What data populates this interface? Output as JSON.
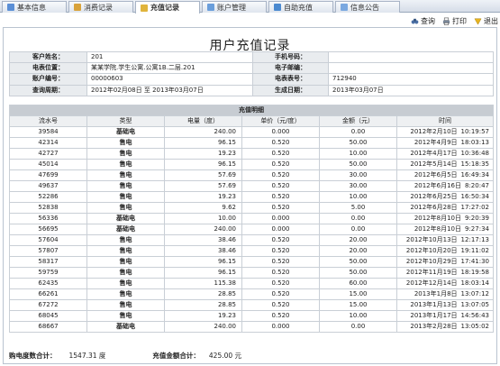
{
  "tabs": [
    {
      "label": "基本信息",
      "active": false
    },
    {
      "label": "消费记录",
      "active": false
    },
    {
      "label": "充值记录",
      "active": true
    },
    {
      "label": "账户管理",
      "active": false
    },
    {
      "label": "自助充值",
      "active": false
    },
    {
      "label": "信息公告",
      "active": false
    }
  ],
  "toolbar": {
    "query": "查询",
    "print": "打印",
    "exit": "退出"
  },
  "page_title": "用户充值记录",
  "info": {
    "name_label": "客户姓名：",
    "name": "201",
    "phone_label": "手机号码：",
    "phone": "",
    "location_label": "电表位置：",
    "location": "某某学院.学生公寓.公寓1B.二层.201",
    "email_label": "电子邮编：",
    "email": "",
    "account_label": "账户编号：",
    "account": "00000603",
    "meter_label": "电表表号：",
    "meter": "712940",
    "period_label": "查询周期：",
    "period": "2012年02月08日  至  2013年03月07日",
    "gen_label": "生成日期：",
    "gen_date": "2013年03月07日"
  },
  "detail": {
    "section_title": "充值明细",
    "headers": [
      "流水号",
      "类型",
      "电量（度）",
      "单价（元/度）",
      "金额（元）",
      "时间"
    ],
    "rows": [
      [
        "39584",
        "基础电",
        "240.00",
        "0.000",
        "0.00",
        "2012年2月10日",
        "10:19:57"
      ],
      [
        "42314",
        "售电",
        "96.15",
        "0.520",
        "50.00",
        "2012年4月9日",
        "18:03:13"
      ],
      [
        "42727",
        "售电",
        "19.23",
        "0.520",
        "10.00",
        "2012年4月17日",
        "10:36:48"
      ],
      [
        "45014",
        "售电",
        "96.15",
        "0.520",
        "50.00",
        "2012年5月14日",
        "15:18:35"
      ],
      [
        "47699",
        "售电",
        "57.69",
        "0.520",
        "30.00",
        "2012年6月5日",
        "16:49:34"
      ],
      [
        "49637",
        "售电",
        "57.69",
        "0.520",
        "30.00",
        "2012年6月16日",
        "8:20:47"
      ],
      [
        "52286",
        "售电",
        "19.23",
        "0.520",
        "10.00",
        "2012年6月25日",
        "16:50:34"
      ],
      [
        "52838",
        "售电",
        "9.62",
        "0.520",
        "5.00",
        "2012年6月28日",
        "17:27:02"
      ],
      [
        "56336",
        "基础电",
        "10.00",
        "0.000",
        "0.00",
        "2012年8月10日",
        "9:20:39"
      ],
      [
        "56695",
        "基础电",
        "240.00",
        "0.000",
        "0.00",
        "2012年8月10日",
        "9:27:34"
      ],
      [
        "57604",
        "售电",
        "38.46",
        "0.520",
        "20.00",
        "2012年10月13日",
        "12:17:13"
      ],
      [
        "57807",
        "售电",
        "38.46",
        "0.520",
        "20.00",
        "2012年10月20日",
        "19:11:02"
      ],
      [
        "58317",
        "售电",
        "96.15",
        "0.520",
        "50.00",
        "2012年10月29日",
        "17:41:30"
      ],
      [
        "59759",
        "售电",
        "96.15",
        "0.520",
        "50.00",
        "2012年11月19日",
        "18:19:58"
      ],
      [
        "62435",
        "售电",
        "115.38",
        "0.520",
        "60.00",
        "2012年12月14日",
        "18:03:14"
      ],
      [
        "66261",
        "售电",
        "28.85",
        "0.520",
        "15.00",
        "2013年1月8日",
        "13:07:12"
      ],
      [
        "67272",
        "售电",
        "28.85",
        "0.520",
        "15.00",
        "2013年1月13日",
        "13:07:05"
      ],
      [
        "68045",
        "售电",
        "19.23",
        "0.520",
        "10.00",
        "2013年1月17日",
        "14:56:43"
      ],
      [
        "68667",
        "基础电",
        "240.00",
        "0.000",
        "0.00",
        "2013年2月28日",
        "13:05:02"
      ]
    ]
  },
  "footer": {
    "kwh_label": "购电度数合计：",
    "kwh_value": "1547.31 度",
    "amount_label": "充值金额合计：",
    "amount_value": "425.00 元"
  },
  "colors": {
    "tab_icons": [
      "#5b8fd6",
      "#d8a23a",
      "#e0b43c",
      "#6a9edb",
      "#4b8ad0",
      "#7aa8e0"
    ]
  }
}
